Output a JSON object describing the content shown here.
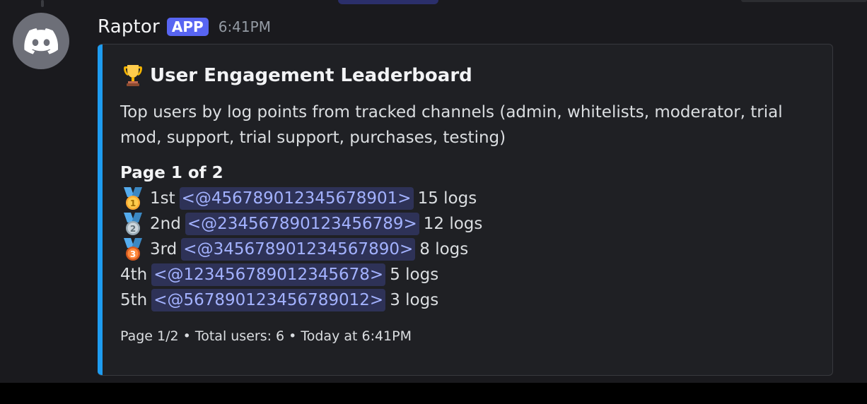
{
  "message": {
    "username": "Raptor",
    "badge": "APP",
    "time": "6:41PM",
    "avatar_icon": "discord-logo-icon"
  },
  "embed": {
    "accent_color": "#1e9cf0",
    "title_icon": "trophy-icon",
    "title": "User Engagement Leaderboard",
    "description": "Top users by log points from tracked channels (admin, whitelists, moderator, trial mod, support, trial support, purchases, testing)",
    "page_heading": "Page 1 of 2",
    "entries": [
      {
        "medal": "gold-medal-icon",
        "rank": "1st",
        "user": "<@456789012345678901>",
        "points": "15 logs"
      },
      {
        "medal": "silver-medal-icon",
        "rank": "2nd",
        "user": "<@234567890123456789>",
        "points": "12 logs"
      },
      {
        "medal": "bronze-medal-icon",
        "rank": "3rd",
        "user": "<@345678901234567890>",
        "points": "8 logs"
      },
      {
        "medal": "",
        "rank": "4th",
        "user": "<@123456789012345678>",
        "points": "5 logs"
      },
      {
        "medal": "",
        "rank": "5th",
        "user": "<@567890123456789012>",
        "points": "3 logs"
      }
    ],
    "footer": {
      "page": "Page 1/2",
      "separator": "•",
      "total": "Total users: 6",
      "timestamp": "Today at 6:41PM"
    }
  },
  "colors": {
    "background": "#1a1a1e",
    "embed_background": "#1f2024",
    "mention_background": "#2e3257",
    "mention_text": "#a3b2ff",
    "badge": "#5865f2"
  }
}
